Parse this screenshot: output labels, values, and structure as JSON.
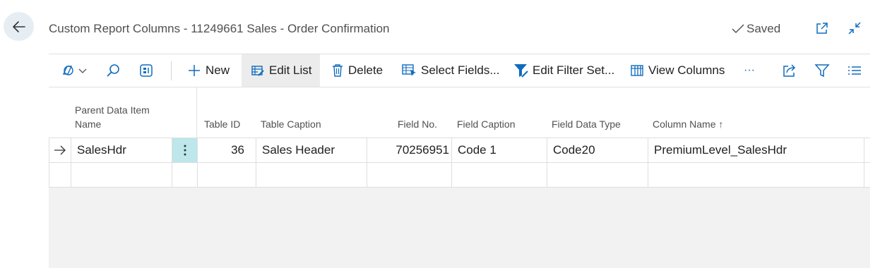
{
  "header": {
    "title": "Custom Report Columns - 11249661 Sales - Order Confirmation",
    "saved_label": "Saved"
  },
  "toolbar": {
    "new_label": "New",
    "edit_list_label": "Edit List",
    "delete_label": "Delete",
    "select_fields_label": "Select Fields...",
    "edit_filter_set_label": "Edit Filter Set...",
    "view_columns_label": "View Columns",
    "more_label": "···"
  },
  "table": {
    "columns": {
      "parent_line1": "Parent Data Item",
      "parent_line2": "Name",
      "table_id": "Table ID",
      "table_caption": "Table Caption",
      "field_no": "Field No.",
      "field_caption": "Field Caption",
      "field_data_type": "Field Data Type",
      "column_name": "Column Name ↑"
    },
    "rows": [
      {
        "parent": "SalesHdr",
        "table_id": "36",
        "table_caption": "Sales Header",
        "field_no": "70256951",
        "field_caption": "Code 1",
        "field_data_type": "Code20",
        "column_name": "PremiumLevel_SalesHdr"
      }
    ]
  },
  "colors": {
    "accent": "#0f6cbd",
    "selected_row_cell": "#bde7ea",
    "active_toolbar_bg": "#ececec"
  }
}
